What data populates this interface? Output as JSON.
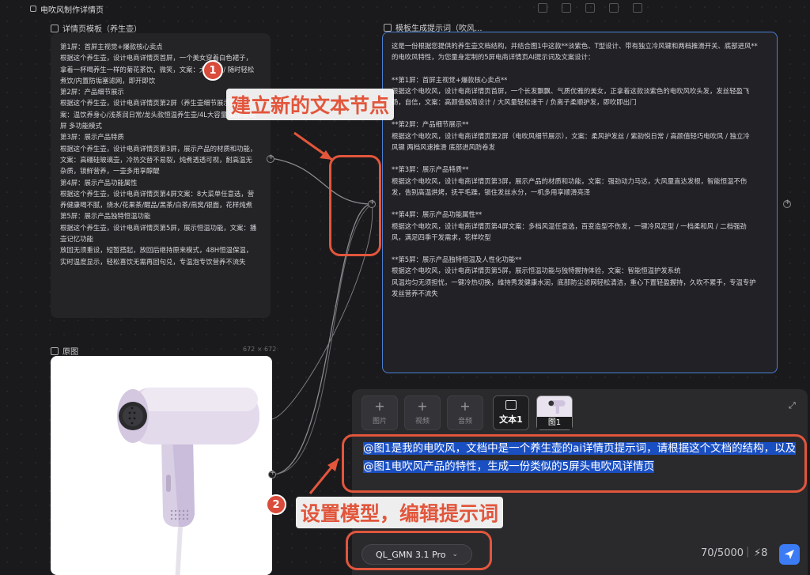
{
  "window": {
    "title": "电吹风制作详情页"
  },
  "template_node": {
    "label": "详情页模板（养生壶）",
    "lines": [
      "第1屏：首屏主视觉+爆款核心卖点",
      "根据这个养生壶，设计电商详情页首屏，一个美女穿着白色裙子，",
      "拿着一杯喝养生一样的菊花茶饮，微笑，文案：大 容量 / 随时轻松",
      "煮饮/内置防垢塞滤网，即开即饮",
      "第2屏：产品细节展示",
      "根据这个养生壶，设计电商详情页第2屏（养生壶细节展示），文",
      "案：温饮养身心/浅茶润日常/龙头款恒温养生壶/4L大容量 高清玻璃",
      "屏 多功能模式",
      "第3屏：展示产品特质",
      "根据这个养生壶，设计电商详情页第3屏，展示产品的材质和功能，",
      "文案：高硼硅玻璃壶，冷热交替不易裂，炖煮透透可视，耐高温无",
      "杂质，锁鲜营养，一壶多用享醇醍",
      "第4屏：展示产品功能属性",
      "根据这个养生壶，设计电商详情页第4屏文案：8大菜单任意选，营",
      "养健康喝不腻，烧水/花果茶/醒品/黑茶/白茶/燕窝/银面，花样炖煮",
      "第5屏：展示产品独特恒温功能",
      "根据这个养生壶，设计电商详情页第5屏，展示恒温功能，文案：播",
      "壶记忆功能",
      "放回无须重设，短暂搭起，放回后继持原来模式，48H恒温保温，",
      "实时温度显示，轻松喜饮无需再回句兑，专温泡专饮营养不流失"
    ]
  },
  "output_node": {
    "label": "模板生成提示词（吹风...",
    "paragraphs": [
      [
        "这是一份根据您提供的养生壶文档结构，并结合图1中这款**淡紫色、T型设计、带有独立冷风键和两档推滑开关、底部进风**",
        "的电吹风特性，为您量身定制的5屏电商详情页AI提示词及文案设计："
      ],
      [
        "**第1屏：首屏主视觉+爆款核心卖点**",
        "根据这个电吹风，设计电商详情页首屏，一个长发飘飘、气质优雅的美女，正拿着这款淡紫色的电吹风吹头发，发丝轻盈飞",
        "扬，自信，文案：高颜值极简设计 / 大风量轻松速干 / 负离子柔顺护发，即吹即出门"
      ],
      [
        "**第2屏：产品细节展示**",
        "根据这个电吹风，设计电商详情页第2屏（电吹风细节展示），文案：柔风护发丝 / 紫韵悦日常 / 高颜值轻巧电吹风 / 独立冷",
        "风键 两档风速推滑 底部进风防卷发"
      ],
      [
        "**第3屏：展示产品特质**",
        "根据这个电吹风，设计电商详情页第3屏，展示产品的材质和功能，文案：强劲动力马达，大风量直达发根，智能恒温不伤",
        "发，告别高温烘烤，抚平毛躁，锁住发丝水分，一机多用享顺滑亮泽"
      ],
      [
        "**第4屏：展示产品功能属性**",
        "根据这个电吹风，设计电商详情页第4屏文案：多档风温任意选，百变造型不伤发，一键冷风定型 / 一档柔和风 / 二档强劲",
        "风，满足四季干发需求，花样吹型"
      ],
      [
        "**第5屏：展示产品独特恒温及人性化功能**",
        "根据这个电吹风，设计电商详情页第5屏，展示恒温功能与独特握持体验，文案：智能恒温护发系统",
        "风温均匀无须担忧，一键冷热切换，维持秀发健康水润，底部防尘滤网轻松清洁，重心下置轻盈握持，久吹不累手，专温专护",
        "发丝营养不流失"
      ]
    ]
  },
  "image_node": {
    "label": "原图",
    "size": "672 × 672"
  },
  "composer": {
    "chips": [
      {
        "label": "图片"
      },
      {
        "label": "视频"
      },
      {
        "label": "音频"
      },
      {
        "label": "文本1"
      },
      {
        "label": "图1"
      }
    ],
    "prompt_text": "@图1是我的电吹风，文档中是一个养生壶的ai详情页提示词，请根据这个文档的结构，以及@图1电吹风产品的特性，生成一份类似的5屏头电吹风详情页",
    "model": "QL_GMN 3.1 Pro",
    "counter": "70/5000",
    "credits": "8"
  },
  "annotations": [
    {
      "number": "1",
      "text": "建立新的文本节点"
    },
    {
      "number": "2",
      "text": "设置模型，编辑提示词"
    }
  ],
  "colors": {
    "accent": "#3b7cf5",
    "annotation": "#e2563c",
    "selection": "#1a4fc2"
  }
}
